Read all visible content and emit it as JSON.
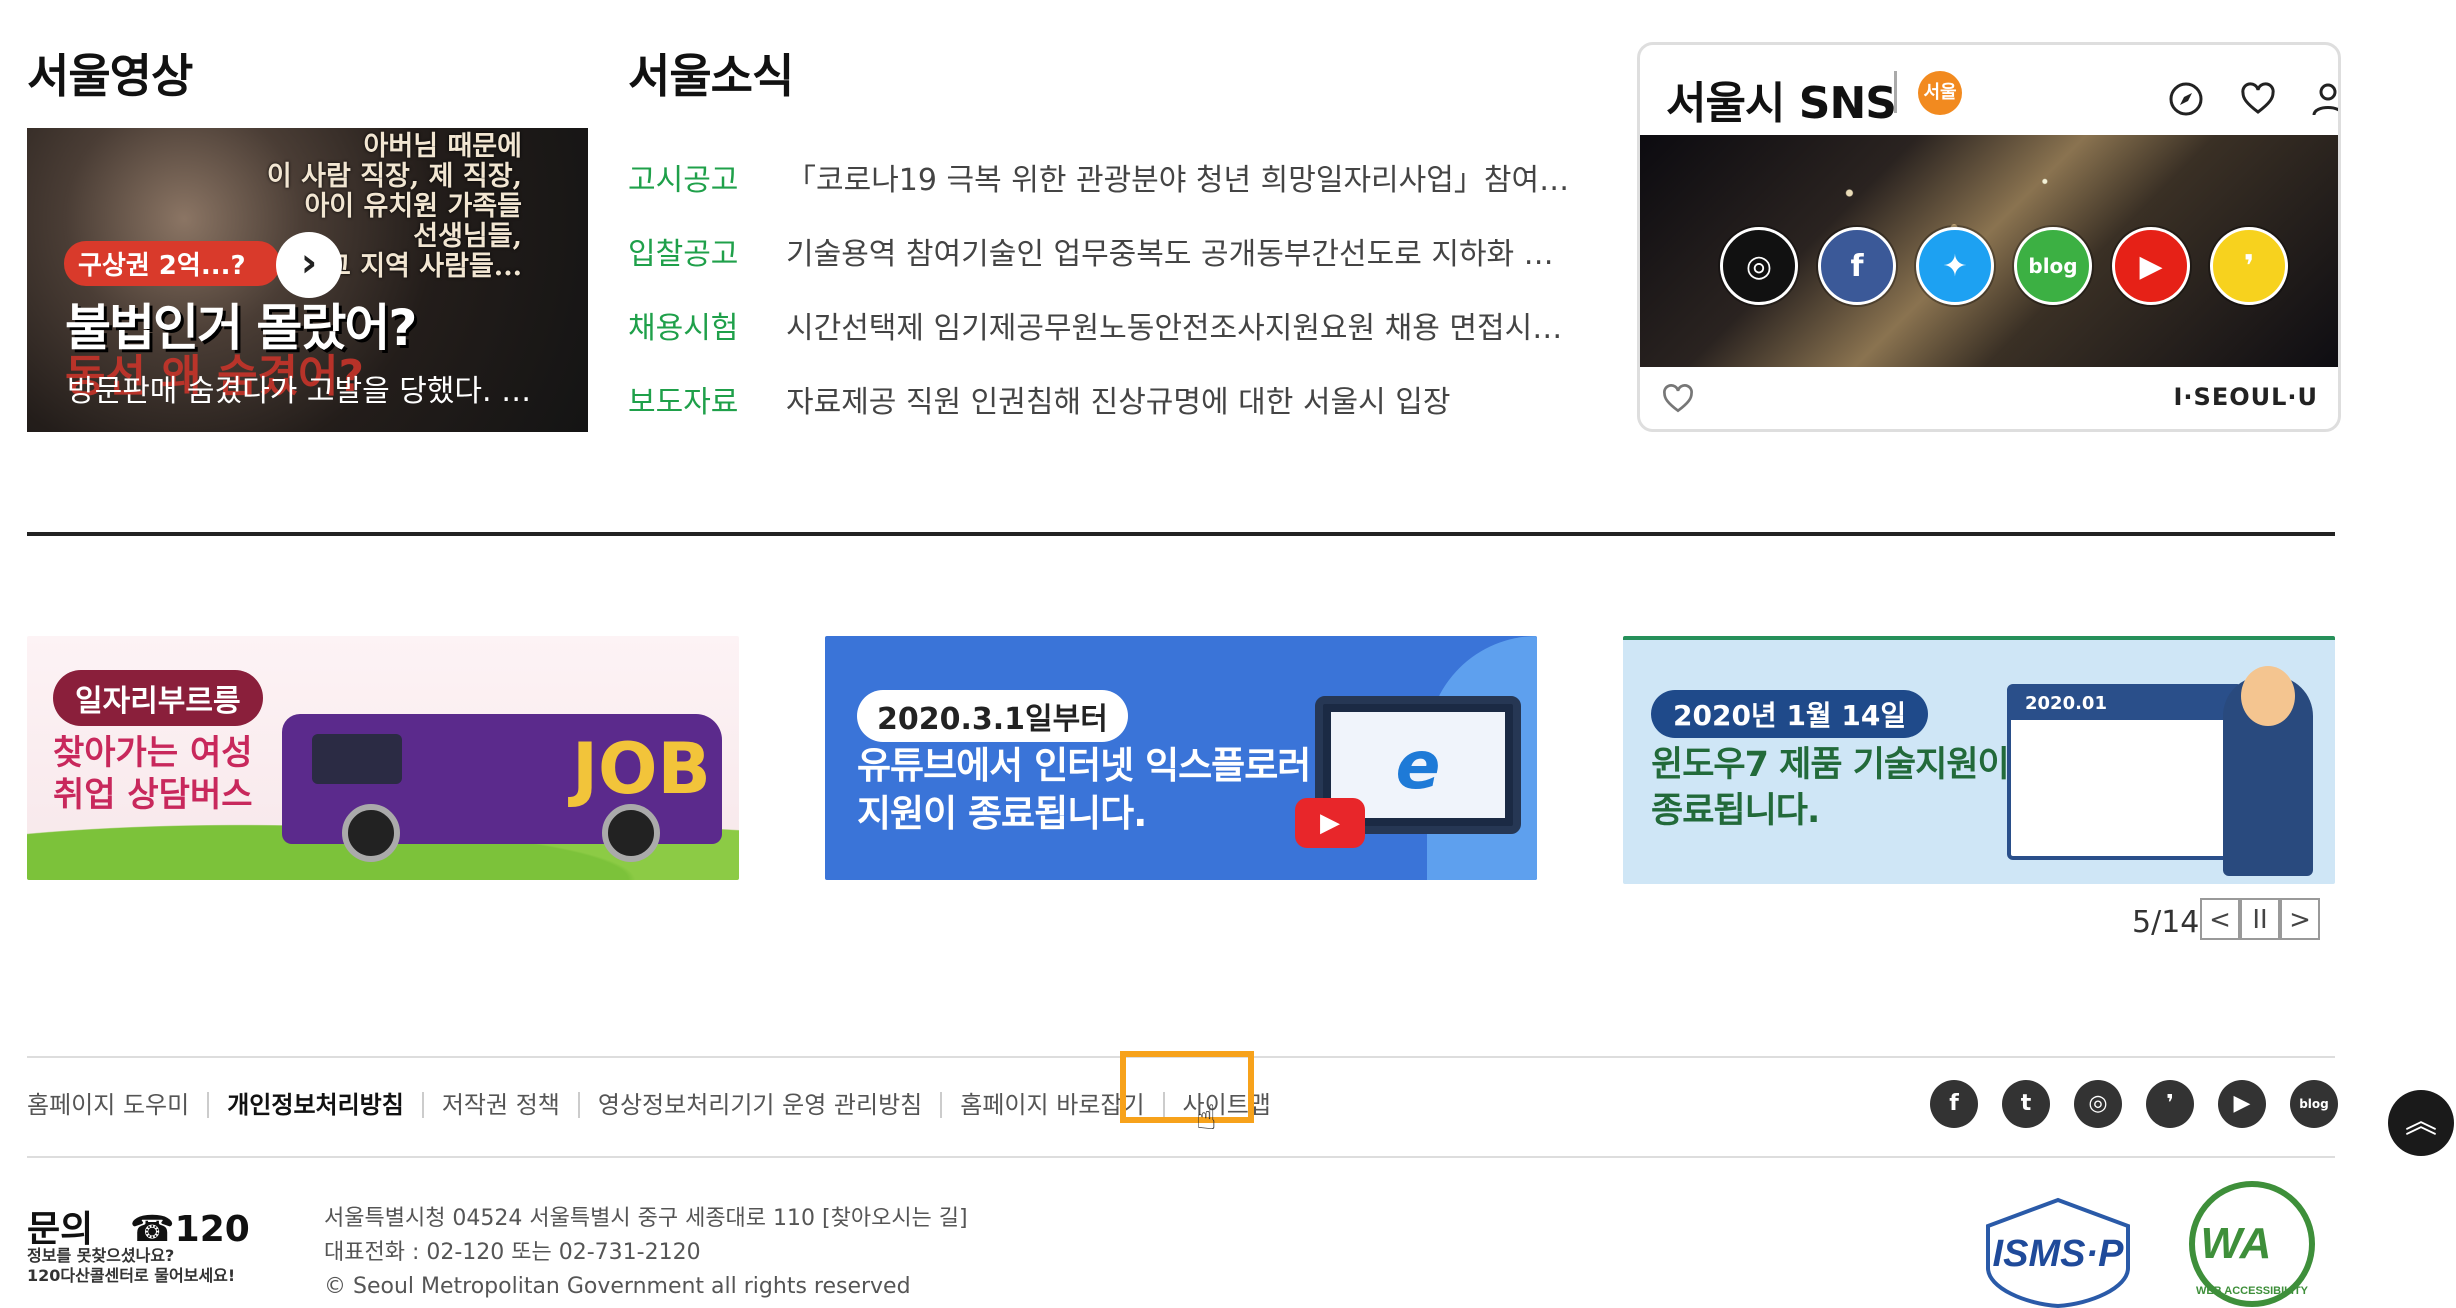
{
  "video": {
    "title": "서울영상",
    "quote_lines": [
      "아버님 때문에",
      "이 사람 직장, 제 직장,",
      "아이 유치원 가족들",
      "선생님들,",
      "그 지역 사람들..."
    ],
    "tag": "구상권 2억...?",
    "headline": "불법인거 몰랐어?",
    "red_subtitle": "동선 왜 숨겼어?",
    "caption": "방문판매 숨겼다가 고발을 당했다. …",
    "play_icon": "chevron-right-icon"
  },
  "news": {
    "title": "서울소식",
    "items": [
      {
        "category": "고시공고",
        "text": "「코로나19 극복 위한 관광분야 청년 희망일자리사업」참여자 …"
      },
      {
        "category": "입찰공고",
        "text": "기술용역 참여기술인 업무중복도 공개동부간선도로 지하화 …"
      },
      {
        "category": "채용시험",
        "text": "시간선택제 임기제공무원노동안전조사지원요원 채용 면접시…"
      },
      {
        "category": "보도자료",
        "text": "자료제공 직원 인권침해 진상규명에 대한 서울시 입장"
      }
    ],
    "category_color": "#1fa04a"
  },
  "sns": {
    "title": "서울시 SNS",
    "logo_text": "서울",
    "tools": [
      "compass-icon",
      "heart-icon",
      "user-icon"
    ],
    "platforms": [
      {
        "name": "instagram",
        "glyph": "◎",
        "color": "#111111"
      },
      {
        "name": "facebook",
        "glyph": "f",
        "color": "#3b5998"
      },
      {
        "name": "twitter",
        "glyph": "✦",
        "color": "#1da1f2"
      },
      {
        "name": "blog",
        "glyph": "blog",
        "color": "#3cb043"
      },
      {
        "name": "youtube",
        "glyph": "▶",
        "color": "#e62117"
      },
      {
        "name": "kakao-story",
        "glyph": "❜",
        "color": "#f7d21e"
      }
    ],
    "brand": "I·SEOUL·U"
  },
  "banners": [
    {
      "tag": "일자리부르릉",
      "title_lines": [
        "찾아가는 여성",
        "취업 상담버스"
      ],
      "bus_text": "JOB"
    },
    {
      "tag": "2020.3.1일부터",
      "title_lines": [
        "유튜브에서 인터넷 익스플로러",
        "지원이 종료됩니다."
      ],
      "icon_letter": "e"
    },
    {
      "tag": "2020년 1월 14일",
      "title_lines": [
        "윈도우7 제품 기술지원이",
        "종료됩니다."
      ],
      "calendar_head": "2020.01"
    }
  ],
  "pager": {
    "text": "5/14",
    "prev": "<",
    "pause": "II",
    "next": ">"
  },
  "footer": {
    "links": [
      "홈페이지 도우미",
      "개인정보처리방침",
      "저작권 정책",
      "영상정보처리기기 운영 관리방침",
      "홈페이지 바로잡기",
      "사이트맵"
    ],
    "social": [
      "f",
      "t",
      "◎",
      "❜",
      "▶",
      "blog"
    ],
    "top_button": "︽",
    "inquiry_label": "문의",
    "inquiry_phone": "☎120",
    "inquiry_sub": [
      "정보를 못찾으셨나요?",
      "120다산콜센터로 물어보세요!"
    ],
    "address": "서울특별시청 04524 서울특별시 중구 세종대로 110 [찾아오시는 길]",
    "phone": "대표전화 : 02-120 또는 02-731-2120",
    "copyright": "© Seoul Metropolitan Government all rights reserved",
    "cert_isms": "ISMS·P",
    "cert_wa": "WA",
    "cert_wa_sub": "WEB ACCESSIBILITY"
  },
  "colors": {
    "accent_orange": "#f7a21b",
    "green": "#1fa04a"
  }
}
